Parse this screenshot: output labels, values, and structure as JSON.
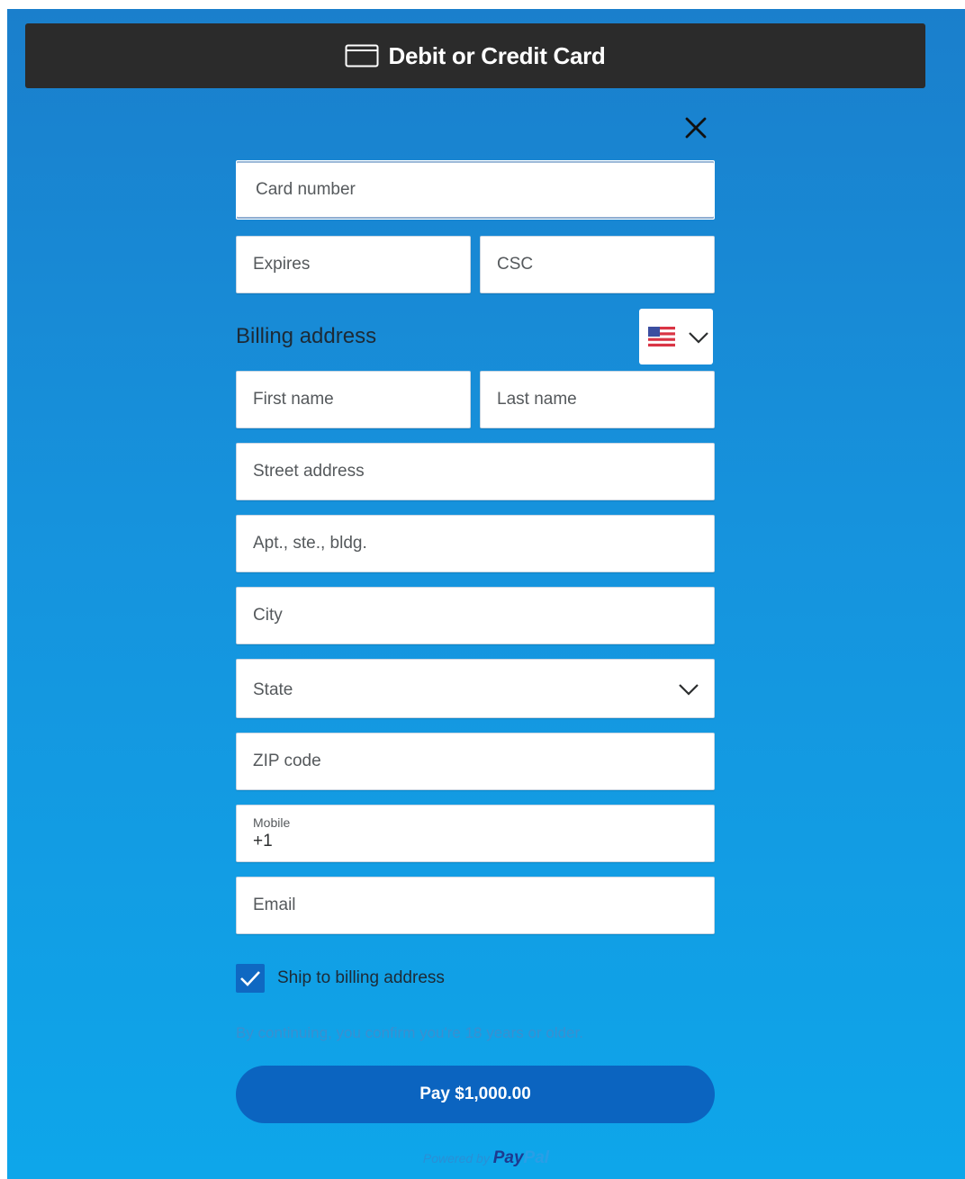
{
  "header": {
    "title": "Debit or Credit Card",
    "icon": "credit-card-icon"
  },
  "close": {
    "icon": "close-icon"
  },
  "card": {
    "number_placeholder": "Card number",
    "expires_placeholder": "Expires",
    "csc_placeholder": "CSC"
  },
  "billing": {
    "title": "Billing address",
    "country_icon": "us-flag-icon",
    "first_name_placeholder": "First name",
    "last_name_placeholder": "Last name",
    "street_placeholder": "Street address",
    "apt_placeholder": "Apt., ste., bldg.",
    "city_placeholder": "City",
    "state_label": "State",
    "zip_placeholder": "ZIP code",
    "mobile_label": "Mobile",
    "mobile_value": "+1",
    "email_placeholder": "Email"
  },
  "shipping": {
    "checkbox_checked": true,
    "label": "Ship to billing address"
  },
  "notice": "By continuing, you confirm you're 18 years or older.",
  "pay_button": "Pay $1,000.00",
  "footer": {
    "powered_by": "Powered by",
    "brand_part1": "Pay",
    "brand_part2": "Pal"
  },
  "colors": {
    "header_bg": "#2b2b2b",
    "gradient_top": "#1a7fcc",
    "gradient_bottom": "#0ea6ea",
    "pay_button": "#0b64c0",
    "checkbox": "#0f68c2"
  }
}
